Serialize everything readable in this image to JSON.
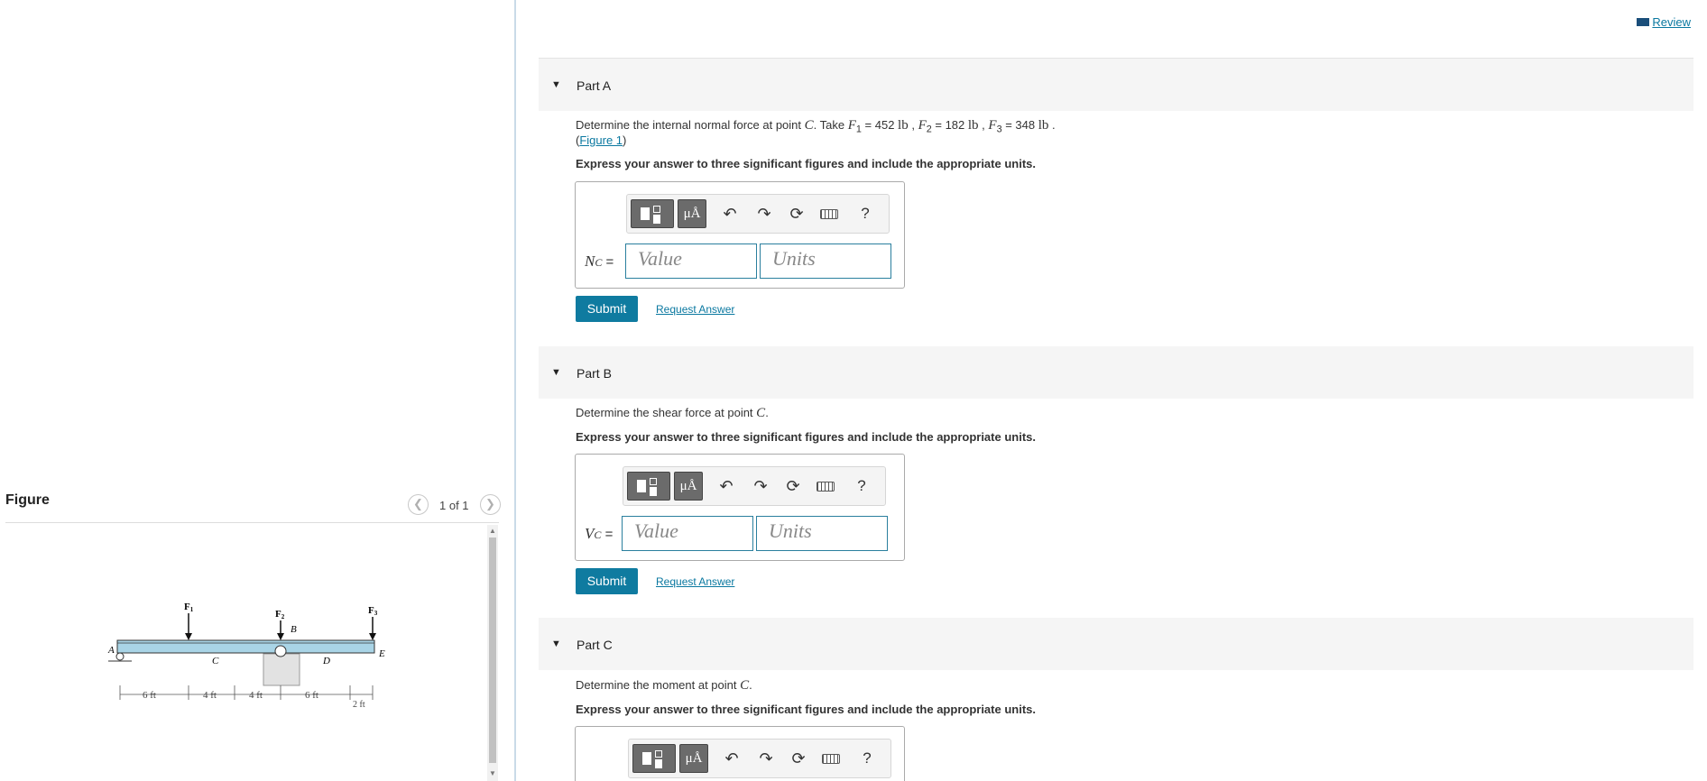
{
  "review": {
    "label": "Review"
  },
  "figure_panel": {
    "title": "Figure",
    "counter": "1 of 1",
    "diagram": {
      "forces": [
        "F",
        "F",
        "F"
      ],
      "force_subscripts": [
        "1",
        "2",
        "3"
      ],
      "points": [
        "A",
        "B",
        "C",
        "D",
        "E"
      ],
      "dimensions": [
        "6 ft",
        "4 ft",
        "4 ft",
        "6 ft",
        "2 ft"
      ]
    }
  },
  "parts": [
    {
      "title": "Part A",
      "question_pre": "Determine the internal normal force at point ",
      "point": "C",
      "question_post": ". Take ",
      "givens": [
        {
          "sym": "F",
          "sub": "1",
          "eq": " = 452 ",
          "unit": "lb"
        },
        {
          "sym": "F",
          "sub": "2",
          "eq": " = 182 ",
          "unit": "lb"
        },
        {
          "sym": "F",
          "sub": "3",
          "eq": " = 348 ",
          "unit": "lb"
        }
      ],
      "figure_link": "Figure 1",
      "instruction": "Express your answer to three significant figures and include the appropriate units.",
      "variable": "N",
      "variable_sub": "C",
      "value_placeholder": "Value",
      "units_placeholder": "Units",
      "submit": "Submit",
      "request": "Request Answer"
    },
    {
      "title": "Part B",
      "question_pre": "Determine the shear force at point ",
      "point": "C",
      "question_post": ".",
      "instruction": "Express your answer to three significant figures and include the appropriate units.",
      "variable": "V",
      "variable_sub": "C",
      "value_placeholder": "Value",
      "units_placeholder": "Units",
      "submit": "Submit",
      "request": "Request Answer"
    },
    {
      "title": "Part C",
      "question_pre": "Determine the moment at point ",
      "point": "C",
      "question_post": ".",
      "instruction": "Express your answer to three significant figures and include the appropriate units."
    }
  ],
  "toolbar": {
    "mu_label": "μÅ",
    "help": "?"
  },
  "eq_sign": " ="
}
